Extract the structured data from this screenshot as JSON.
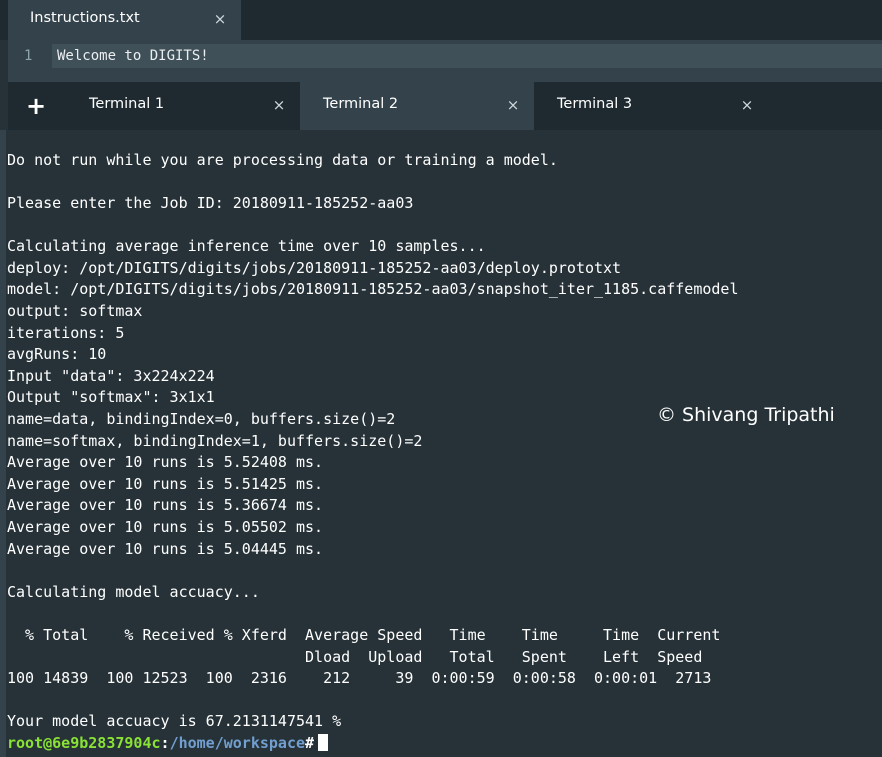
{
  "editor": {
    "tab": {
      "label": "Instructions.txt",
      "close_glyph": "×"
    },
    "lines": [
      {
        "number": "1",
        "text": "Welcome to DIGITS!"
      }
    ]
  },
  "terminal_tabs": {
    "add_glyph": "+",
    "close_glyph": "×",
    "tabs": [
      {
        "label": "Terminal 1",
        "active": false
      },
      {
        "label": "Terminal 2",
        "active": true
      },
      {
        "label": "Terminal 3",
        "active": false
      }
    ]
  },
  "terminal": {
    "lines": [
      "Do not run while you are processing data or training a model.",
      "Please enter the Job ID: 20180911-185252-aa03",
      "Calculating average inference time over 10 samples...",
      "deploy: /opt/DIGITS/digits/jobs/20180911-185252-aa03/deploy.prototxt",
      "model: /opt/DIGITS/digits/jobs/20180911-185252-aa03/snapshot_iter_1185.caffemodel",
      "output: softmax",
      "iterations: 5",
      "avgRuns: 10",
      "Input \"data\": 3x224x224",
      "Output \"softmax\": 3x1x1",
      "name=data, bindingIndex=0, buffers.size()=2",
      "name=softmax, bindingIndex=1, buffers.size()=2",
      "Average over 10 runs is 5.52408 ms.",
      "Average over 10 runs is 5.51425 ms.",
      "Average over 10 runs is 5.36674 ms.",
      "Average over 10 runs is 5.05502 ms.",
      "Average over 10 runs is 5.04445 ms.",
      "Calculating model accuacy...",
      "  % Total    % Received % Xferd  Average Speed   Time    Time     Time  Current",
      "                                 Dload  Upload   Total   Spent    Left  Speed",
      "100 14839  100 12523  100  2316    212     39  0:00:59  0:00:58  0:00:01  2713",
      "Your model accuacy is 67.2131147541 %"
    ],
    "prompt": {
      "user_host": "root@6e9b2837904c",
      "separator": ":",
      "path": "/home/workspace",
      "symbol": "#"
    }
  },
  "watermark": "© Shivang Tripathi",
  "colors": {
    "background": "#263238",
    "tab_active": "#34434b",
    "tab_bar": "#1e2a30",
    "prompt_user": "#8ae234",
    "prompt_path": "#729fcf"
  }
}
